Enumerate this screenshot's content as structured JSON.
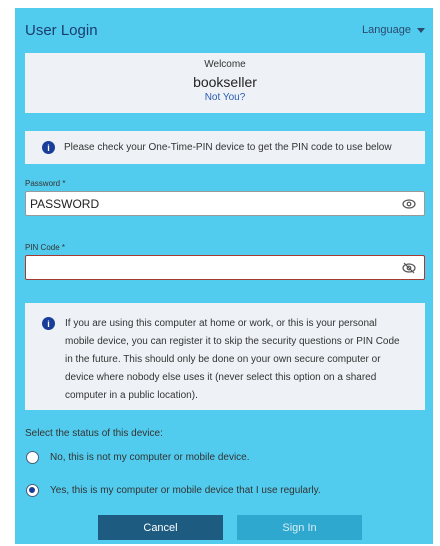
{
  "header": {
    "title": "User Login",
    "language_label": "Language"
  },
  "welcome": {
    "greeting": "Welcome",
    "username": "bookseller",
    "not_you": "Not You?"
  },
  "otp_notice": "Please check your One-Time-PIN device to get the PIN code to use below",
  "password": {
    "label": "Password *",
    "value": "PASSWORD"
  },
  "pin": {
    "label": "PIN Code *",
    "value": ""
  },
  "device_notice": "If you are using this computer at home or work, or this is your personal mobile device, you can register it to skip the security questions or PIN Code in the future. This should only be done on your own secure computer or device where nobody else uses it (never select this option on a shared computer in a public location).",
  "device_status": {
    "label": "Select the status of this device:",
    "options": [
      {
        "label": "No, this is not my computer or mobile device.",
        "selected": false
      },
      {
        "label": "Yes, this is my computer or mobile device that I use regularly.",
        "selected": true
      }
    ]
  },
  "buttons": {
    "cancel": "Cancel",
    "sign_in": "Sign In"
  },
  "colors": {
    "background": "#52ccee",
    "cancel": "#1d5c80",
    "sign_in": "#2ea8cf",
    "info_icon": "#1a3d9a"
  }
}
